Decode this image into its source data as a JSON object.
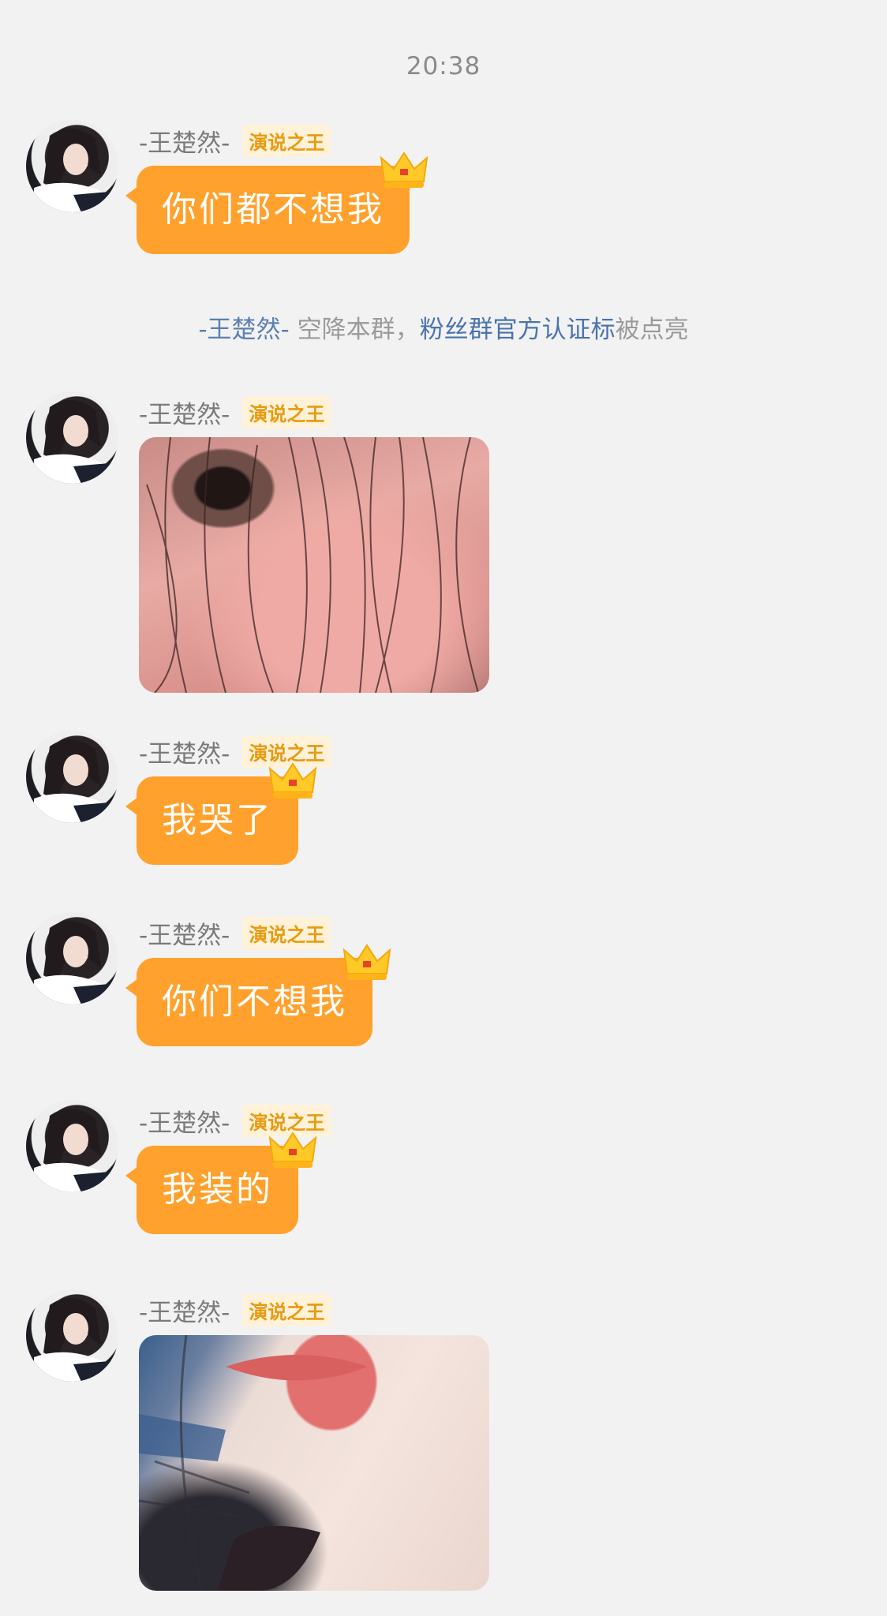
{
  "time": "20:38",
  "system_notice": {
    "name": "-王楚然-",
    "text1": " 空降本群，",
    "link": "粉丝群官方认证标",
    "text2": "被点亮"
  },
  "sender": {
    "name": "-王楚然-",
    "badge": "演说之王"
  },
  "messages": [
    {
      "type": "text",
      "text": "你们都不想我"
    },
    {
      "type": "image",
      "content": "eye-photo"
    },
    {
      "type": "text",
      "text": "我哭了"
    },
    {
      "type": "text",
      "text": "你们不想我"
    },
    {
      "type": "text",
      "text": "我装的"
    },
    {
      "type": "image",
      "content": "lips-photo"
    }
  ],
  "colors": {
    "bubble": "#ffa12c",
    "badge_text": "#e79a0f",
    "link": "#4a74ad",
    "background": "#f2f2f2"
  },
  "icons": [
    "crown-icon"
  ]
}
